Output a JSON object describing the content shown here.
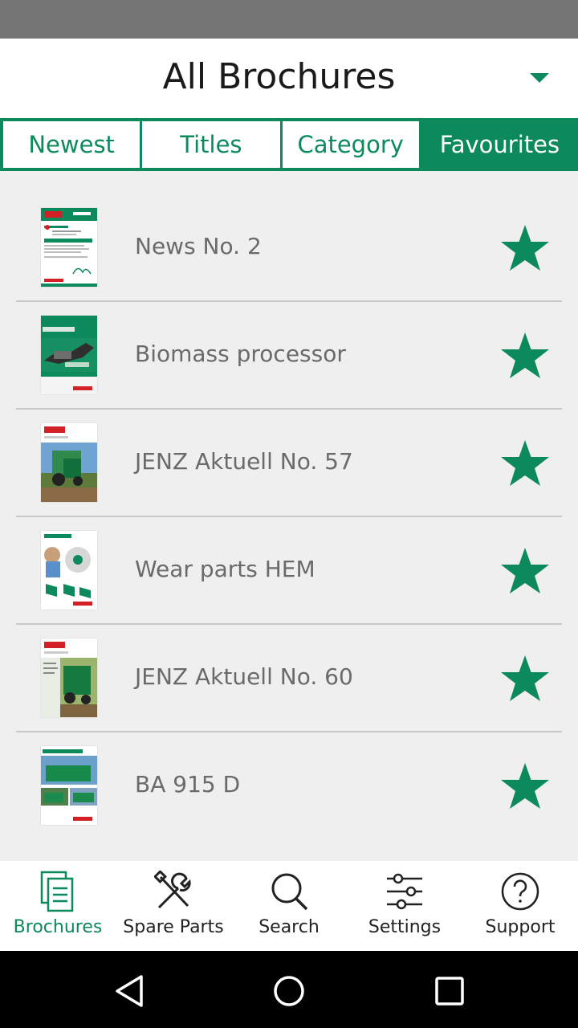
{
  "header": {
    "title": "All Brochures",
    "dropdown_icon": "chevron-down-icon"
  },
  "tabs": [
    {
      "label": "Newest",
      "active": false
    },
    {
      "label": "Titles",
      "active": false
    },
    {
      "label": "Category",
      "active": false
    },
    {
      "label": "Favourites",
      "active": true
    }
  ],
  "brochures": [
    {
      "title": "News No. 2",
      "favourite": true,
      "thumb_icon": "brochure-cover"
    },
    {
      "title": "Biomass processor",
      "favourite": true,
      "thumb_icon": "brochure-cover"
    },
    {
      "title": "JENZ Aktuell No. 57",
      "favourite": true,
      "thumb_icon": "brochure-cover"
    },
    {
      "title": "Wear parts HEM",
      "favourite": true,
      "thumb_icon": "brochure-cover"
    },
    {
      "title": "JENZ Aktuell No. 60",
      "favourite": true,
      "thumb_icon": "brochure-cover"
    },
    {
      "title": "BA 915 D",
      "favourite": true,
      "thumb_icon": "brochure-cover"
    }
  ],
  "bottom_nav": [
    {
      "label": "Brochures",
      "icon": "document-icon",
      "active": true
    },
    {
      "label": "Spare Parts",
      "icon": "tools-icon",
      "active": false
    },
    {
      "label": "Search",
      "icon": "search-icon",
      "active": false
    },
    {
      "label": "Settings",
      "icon": "sliders-icon",
      "active": false
    },
    {
      "label": "Support",
      "icon": "help-icon",
      "active": false
    }
  ],
  "colors": {
    "brand": "#0c8a5b",
    "background": "#efefef",
    "text_muted": "#6a6a6a"
  }
}
